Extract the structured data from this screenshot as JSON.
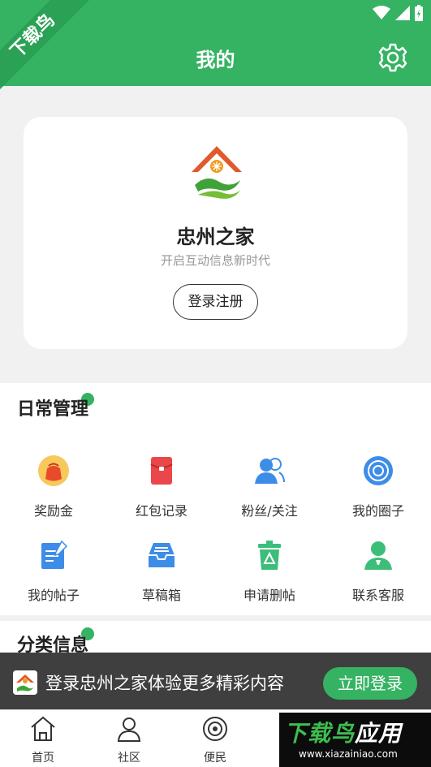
{
  "header": {
    "title": "我的",
    "ribbon_text": "下载鸟"
  },
  "profile": {
    "app_name": "忠州之家",
    "slogan": "开启互动信息新时代",
    "login_label": "登录注册"
  },
  "daily": {
    "title": "日常管理",
    "items": [
      {
        "label": "奖励金",
        "icon": "reward-bag-icon"
      },
      {
        "label": "红包记录",
        "icon": "red-packet-icon"
      },
      {
        "label": "粉丝/关注",
        "icon": "followers-icon"
      },
      {
        "label": "我的圈子",
        "icon": "circle-target-icon"
      },
      {
        "label": "我的帖子",
        "icon": "edit-post-icon"
      },
      {
        "label": "草稿箱",
        "icon": "drafts-tray-icon"
      },
      {
        "label": "申请删帖",
        "icon": "trash-bin-icon"
      },
      {
        "label": "联系客服",
        "icon": "customer-service-icon"
      }
    ]
  },
  "category": {
    "title": "分类信息"
  },
  "banner": {
    "text": "登录忠州之家体验更多精彩内容",
    "button_label": "立即登录"
  },
  "tabs": [
    {
      "label": "首页",
      "icon": "home-icon"
    },
    {
      "label": "社区",
      "icon": "community-icon"
    },
    {
      "label": "便民",
      "icon": "convenience-icon"
    }
  ],
  "watermark": {
    "main_green": "下载鸟",
    "main_white": "应用",
    "url": "www.xiazainiao.com"
  },
  "colors": {
    "brand_green": "#35b362",
    "banner_bg": "#3f3f3f"
  }
}
